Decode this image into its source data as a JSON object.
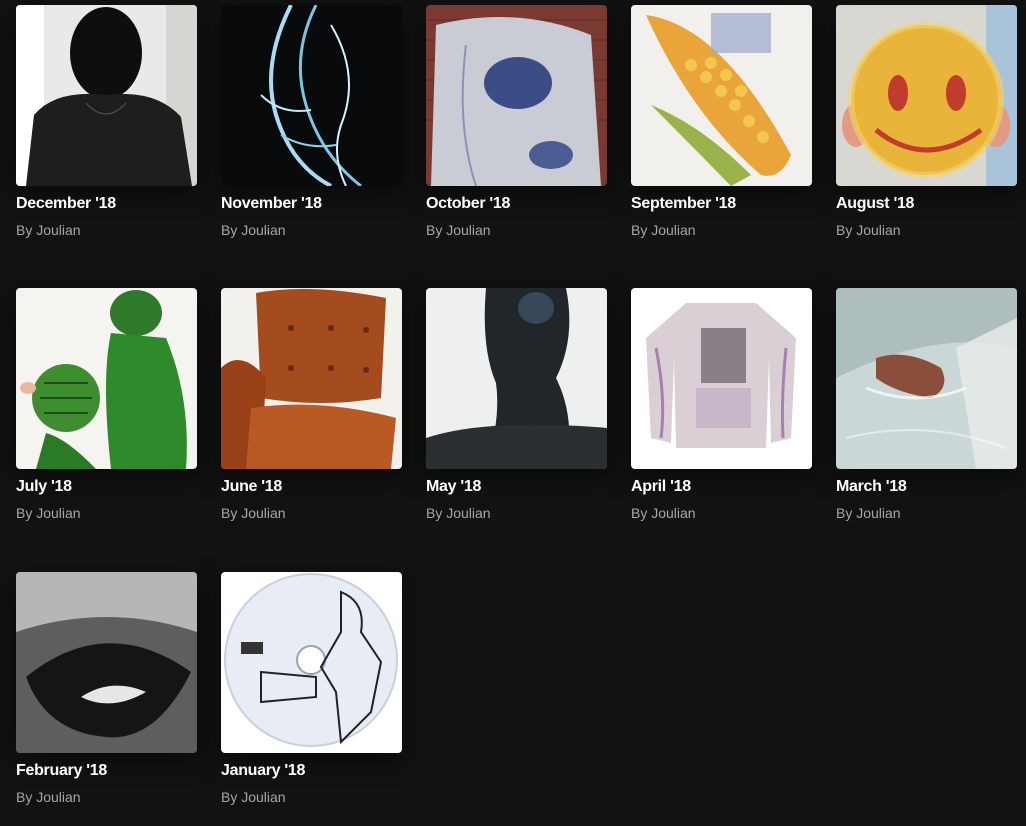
{
  "playlists": [
    {
      "title": "December '18",
      "subtitle": "By Joulian",
      "artwork": "dark-silhouette-art"
    },
    {
      "title": "November '18",
      "subtitle": "By Joulian",
      "artwork": "chrome-body-art"
    },
    {
      "title": "October '18",
      "subtitle": "By Joulian",
      "artwork": "denim-jacket-art"
    },
    {
      "title": "September '18",
      "subtitle": "By Joulian",
      "artwork": "corn-art"
    },
    {
      "title": "August '18",
      "subtitle": "By Joulian",
      "artwork": "smiley-face-art"
    },
    {
      "title": "July '18",
      "subtitle": "By Joulian",
      "artwork": "watermelon-costume-art"
    },
    {
      "title": "June '18",
      "subtitle": "By Joulian",
      "artwork": "leather-chair-art"
    },
    {
      "title": "May '18",
      "subtitle": "By Joulian",
      "artwork": "backlit-figure-art"
    },
    {
      "title": "April '18",
      "subtitle": "By Joulian",
      "artwork": "printed-shirt-art"
    },
    {
      "title": "March '18",
      "subtitle": "By Joulian",
      "artwork": "hand-in-water-art"
    },
    {
      "title": "February '18",
      "subtitle": "By Joulian",
      "artwork": "lips-art"
    },
    {
      "title": "January '18",
      "subtitle": "By Joulian",
      "artwork": "cd-disc-art"
    }
  ]
}
